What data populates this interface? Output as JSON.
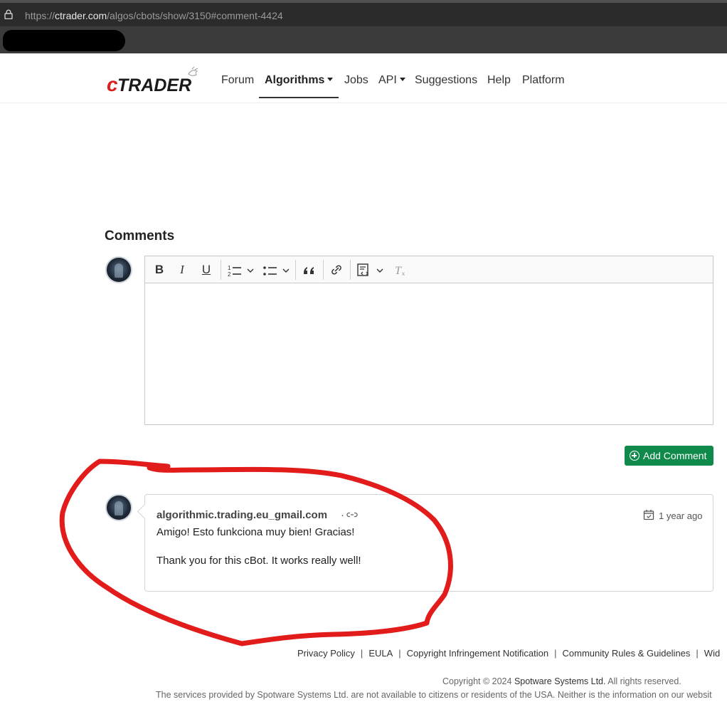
{
  "browser": {
    "url_prefix": "https://",
    "url_host": "ctrader.com",
    "url_path": "/algos/cbots/show/3150#comment-4424"
  },
  "nav": {
    "logo_text": "cTRADER",
    "items": [
      {
        "label": "Forum"
      },
      {
        "label": "Algorithms"
      },
      {
        "label": "Jobs"
      },
      {
        "label": "API"
      },
      {
        "label": "Suggestions"
      },
      {
        "label": "Help"
      },
      {
        "label": "Platform"
      }
    ],
    "active": "Algorithms"
  },
  "comments": {
    "heading": "Comments",
    "editor": {
      "toolbar": {
        "bold_label": "B",
        "italic_label": "I",
        "underline_label": "U",
        "icons": [
          "bold-icon",
          "italic-icon",
          "underline-icon",
          "numbered-list-icon",
          "bulleted-list-icon",
          "blockquote-icon",
          "link-icon",
          "source-code-icon",
          "remove-format-icon"
        ]
      }
    },
    "add_button_label": "Add Comment",
    "list": [
      {
        "author": "algorithmic.trading.eu_gmail.com",
        "separator": "·",
        "time": "1 year ago",
        "paragraphs": [
          "Amigo! Esto funkciona muy bien! Gracias!",
          "Thank you for this cBot. It works really well!"
        ]
      }
    ]
  },
  "footer": {
    "links": [
      "Privacy Policy",
      "EULA",
      "Copyright Infringement Notification",
      "Community Rules & Guidelines",
      "Wid"
    ],
    "separator": "|",
    "copyright_prefix": "Copyright © 2024 ",
    "copyright_company": "Spotware Systems Ltd.",
    "copyright_suffix": " All rights reserved.",
    "disclaimer": "The services provided by Spotware Systems Ltd. are not available to citizens or residents of the USA. Neither is the information on our websit"
  },
  "colors": {
    "brand_red": "#d9201f",
    "add_button": "#0f8a4a",
    "annotation_red": "#e21b1b"
  }
}
